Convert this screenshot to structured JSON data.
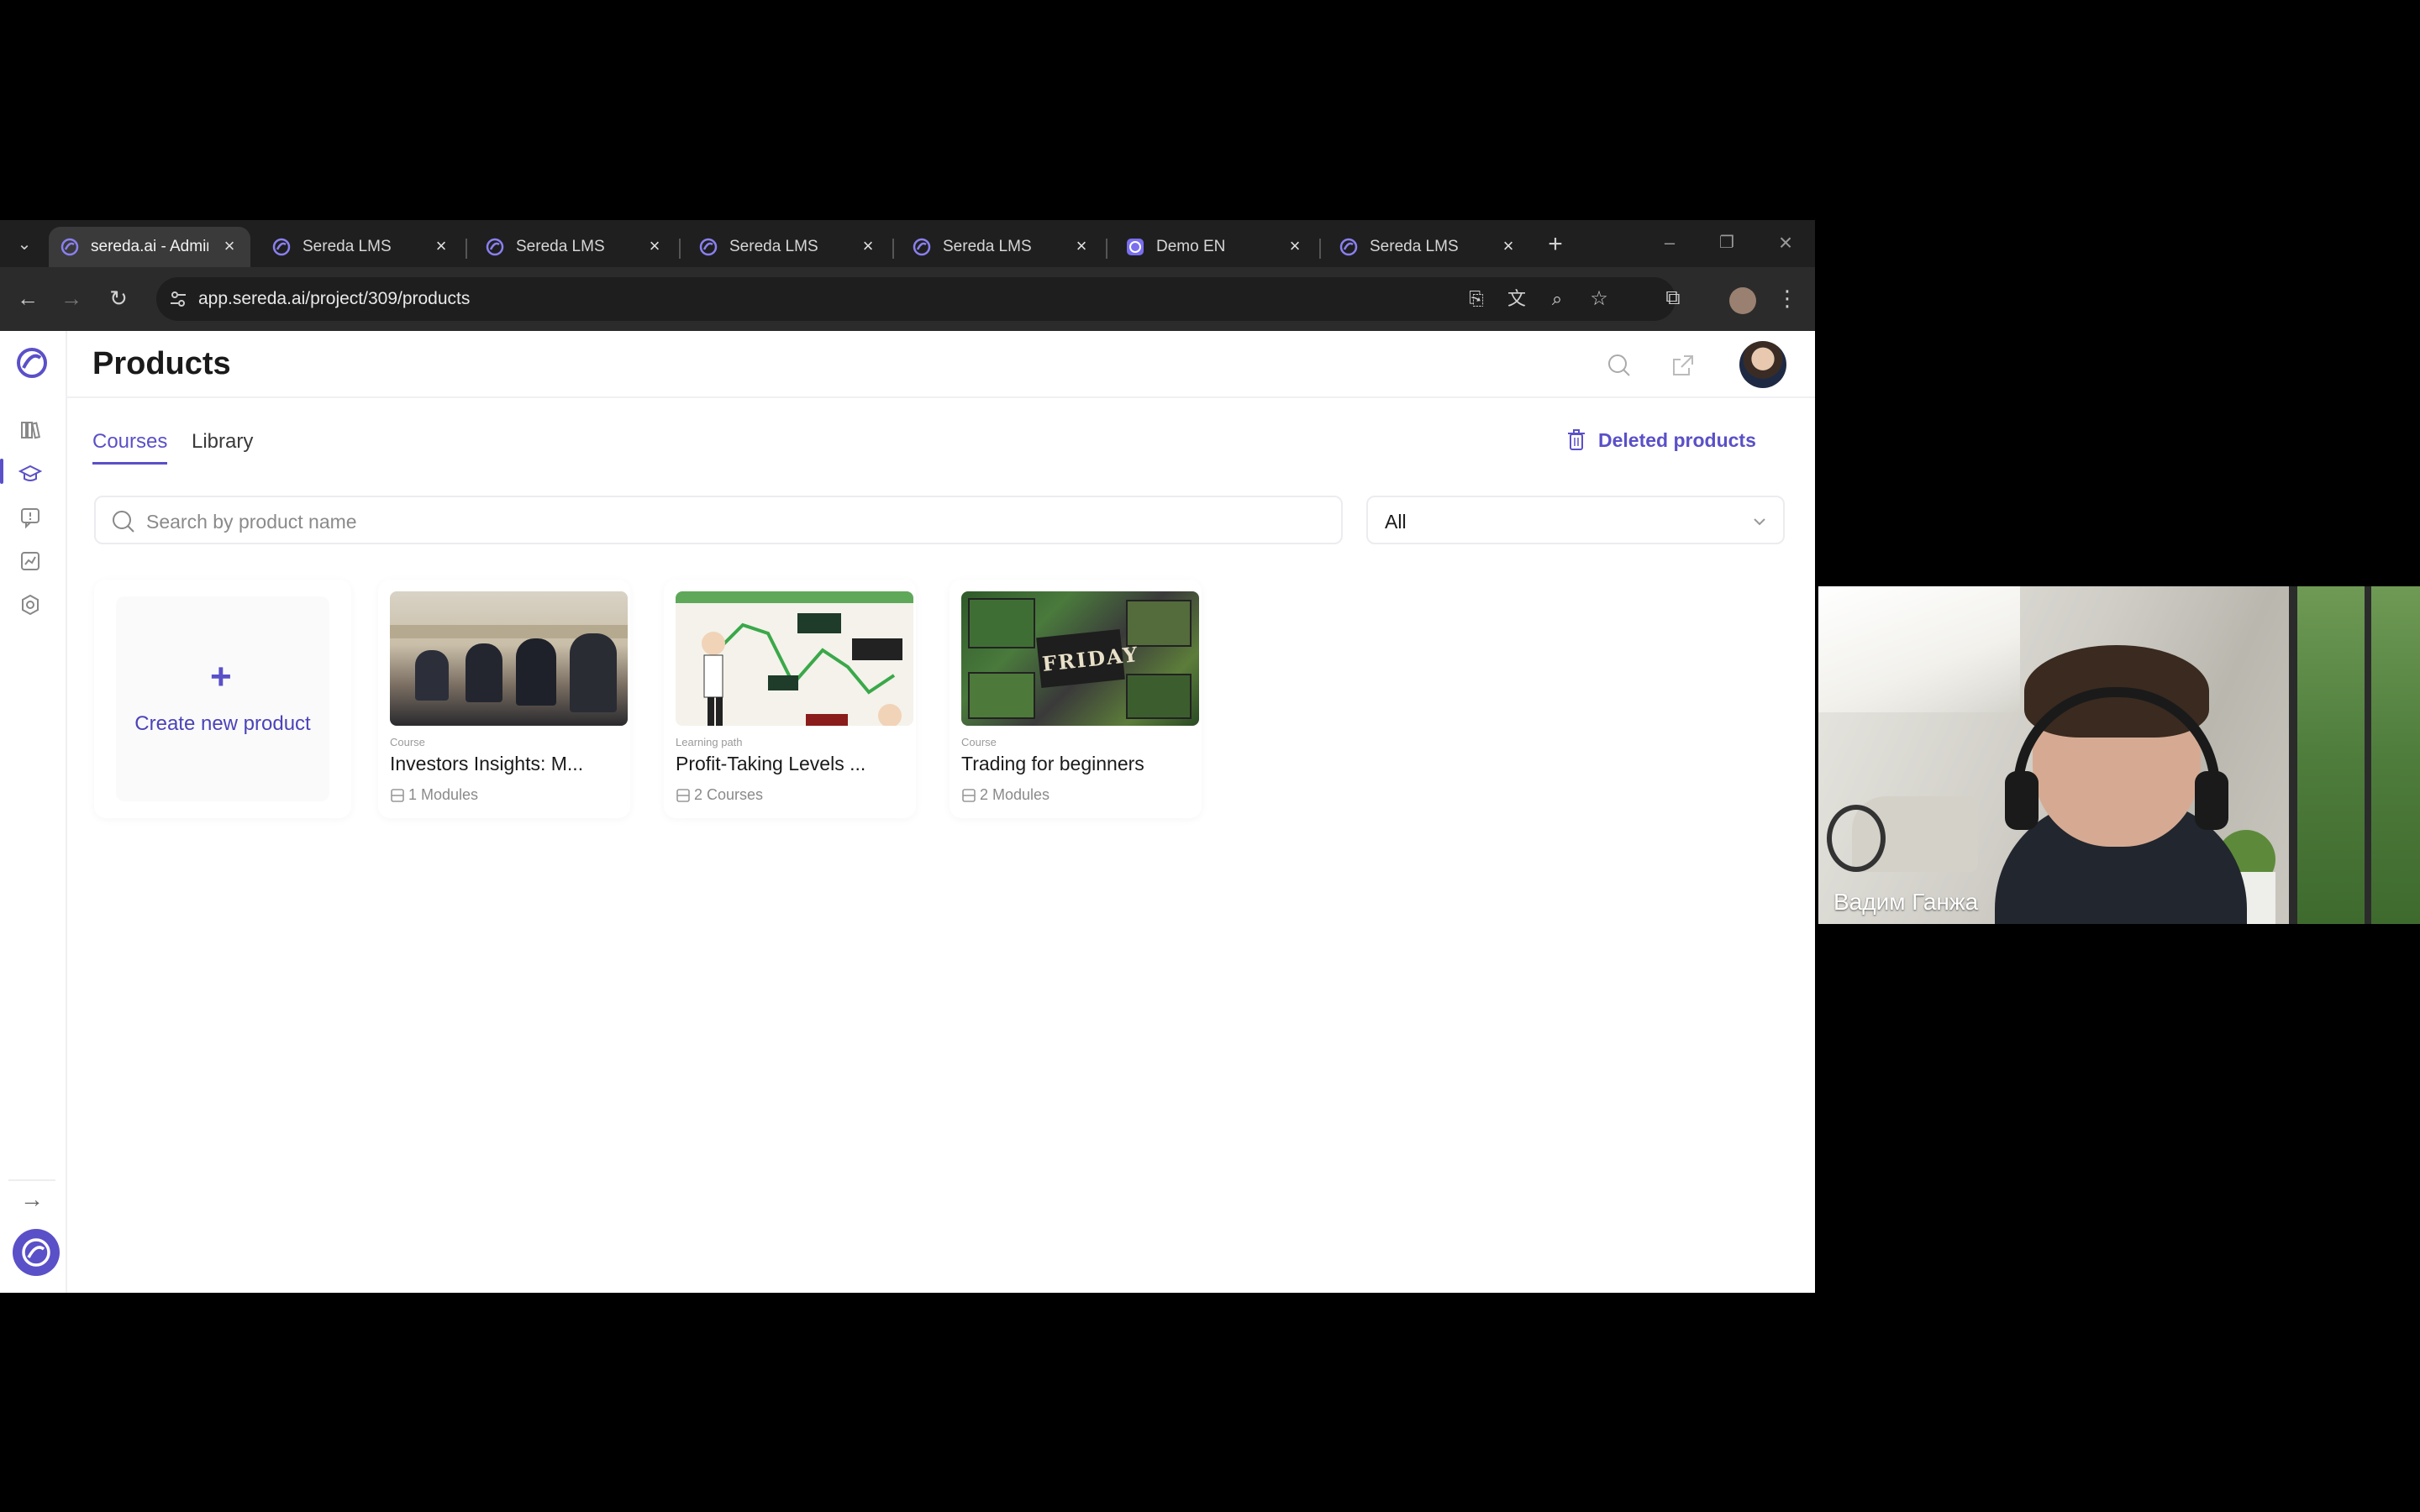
{
  "browser": {
    "tabs": [
      {
        "title": "sereda.ai - Admin",
        "active": true
      },
      {
        "title": "Sereda LMS",
        "active": false
      },
      {
        "title": "Sereda LMS",
        "active": false
      },
      {
        "title": "Sereda LMS",
        "active": false
      },
      {
        "title": "Sereda LMS",
        "active": false
      },
      {
        "title": "Demo EN",
        "active": false
      },
      {
        "title": "Sereda LMS",
        "active": false
      }
    ],
    "url": "app.sereda.ai/project/309/products"
  },
  "header": {
    "title": "Products"
  },
  "nav": {
    "tab_courses": "Courses",
    "tab_library": "Library",
    "deleted_products": "Deleted products"
  },
  "search": {
    "placeholder": "Search by product name"
  },
  "filter": {
    "selected": "All"
  },
  "create": {
    "label": "Create new product"
  },
  "products": [
    {
      "type": "Course",
      "name": "Investors Insights: M...",
      "meta": "1 Modules"
    },
    {
      "type": "Learning path",
      "name": "Profit-Taking Levels ...",
      "meta": "2 Courses"
    },
    {
      "type": "Course",
      "name": "Trading for beginners",
      "meta": "2 Modules"
    }
  ],
  "video": {
    "participant_name": "Вадим Ганжа"
  },
  "colors": {
    "accent": "#5a50c8",
    "chrome_dark": "#1f1f1f",
    "chrome_toolbar": "#2b2b2b"
  }
}
